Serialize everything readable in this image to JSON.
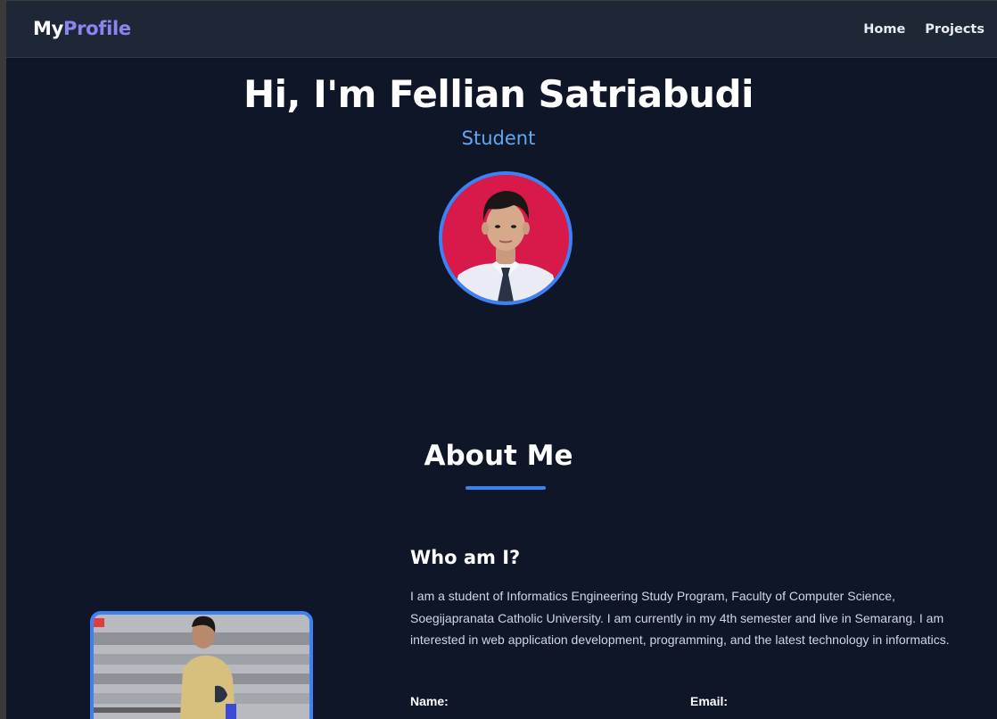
{
  "navbar": {
    "brand_part1": "My",
    "brand_part2": "Profile",
    "links": [
      {
        "label": "Home"
      },
      {
        "label": "Projects"
      }
    ]
  },
  "hero": {
    "title": "Hi, I'm Fellian Satriabudi",
    "subtitle": "Student"
  },
  "about": {
    "title": "About Me",
    "who_title": "Who am I?",
    "who_text": "I am a student of Informatics Engineering Study Program, Faculty of Computer Science, Soegijapranata Catholic University. I am currently in my 4th semester and live in Semarang. I am interested in web application development, programming, and the latest technology in informatics.",
    "name_label": "Name:",
    "email_label": "Email:"
  },
  "colors": {
    "background": "#0f1628",
    "navbar": "#1e2736",
    "accent": "#3b82f6",
    "brand_accent": "#8b85f0",
    "subtitle": "#63a7ee"
  }
}
